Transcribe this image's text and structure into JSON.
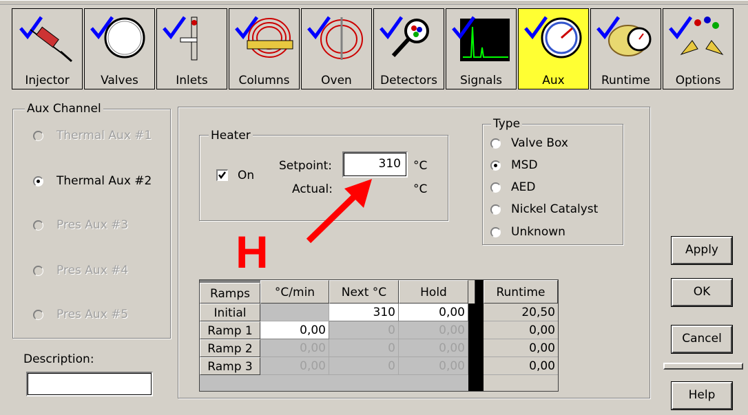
{
  "toolbar": {
    "items": [
      {
        "label": "Injector",
        "icon": "injector-syringe-icon"
      },
      {
        "label": "Valves",
        "icon": "valves-icon"
      },
      {
        "label": "Inlets",
        "icon": "inlets-icon"
      },
      {
        "label": "Columns",
        "icon": "columns-icon"
      },
      {
        "label": "Oven",
        "icon": "oven-icon"
      },
      {
        "label": "Detectors",
        "icon": "detectors-magnifier-icon"
      },
      {
        "label": "Signals",
        "icon": "signals-chart-icon"
      },
      {
        "label": "Aux",
        "icon": "aux-gauge-icon"
      },
      {
        "label": "Runtime",
        "icon": "runtime-stopwatch-icon"
      },
      {
        "label": "Options",
        "icon": "options-icon"
      }
    ],
    "active": "Aux",
    "active_color": "#ffff33",
    "check_color": "#0000ff"
  },
  "aux_channel": {
    "title": "Aux Channel",
    "options": [
      {
        "label": "Thermal Aux #1",
        "enabled": false,
        "selected": false
      },
      {
        "label": "Thermal Aux #2",
        "enabled": true,
        "selected": true
      },
      {
        "label": "Pres Aux #3",
        "enabled": false,
        "selected": false
      },
      {
        "label": "Pres Aux #4",
        "enabled": false,
        "selected": false
      },
      {
        "label": "Pres Aux #5",
        "enabled": false,
        "selected": false
      }
    ]
  },
  "description": {
    "label": "Description:",
    "value": ""
  },
  "heater": {
    "title": "Heater",
    "on_label": "On",
    "on_checked": true,
    "setpoint_label": "Setpoint:",
    "setpoint_value": "310",
    "setpoint_unit": "°C",
    "actual_label": "Actual:",
    "actual_unit": "°C"
  },
  "type": {
    "title": "Type",
    "options": [
      {
        "label": "Valve Box",
        "selected": false
      },
      {
        "label": "MSD",
        "selected": true
      },
      {
        "label": "AED",
        "selected": false
      },
      {
        "label": "Nickel Catalyst",
        "selected": false
      },
      {
        "label": "Unknown",
        "selected": false
      }
    ]
  },
  "annotation": {
    "letter": "H",
    "color": "#ff0000"
  },
  "ramps": {
    "headers": [
      "Ramps",
      "°C/min",
      "Next °C",
      "Hold",
      "Runtime"
    ],
    "rows": [
      {
        "name": "Initial",
        "rate": "",
        "next": "310",
        "hold": "0,00",
        "runtime": "20,50"
      },
      {
        "name": "Ramp 1",
        "rate": "0,00",
        "next": "0",
        "hold": "0,00",
        "runtime": "0,00"
      },
      {
        "name": "Ramp 2",
        "rate": "0,00",
        "next": "0",
        "hold": "0,00",
        "runtime": "0,00"
      },
      {
        "name": "Ramp 3",
        "rate": "0,00",
        "next": "0",
        "hold": "0,00",
        "runtime": "0,00"
      }
    ]
  },
  "buttons": {
    "apply": "Apply",
    "ok": "OK",
    "cancel": "Cancel",
    "help": "Help"
  }
}
